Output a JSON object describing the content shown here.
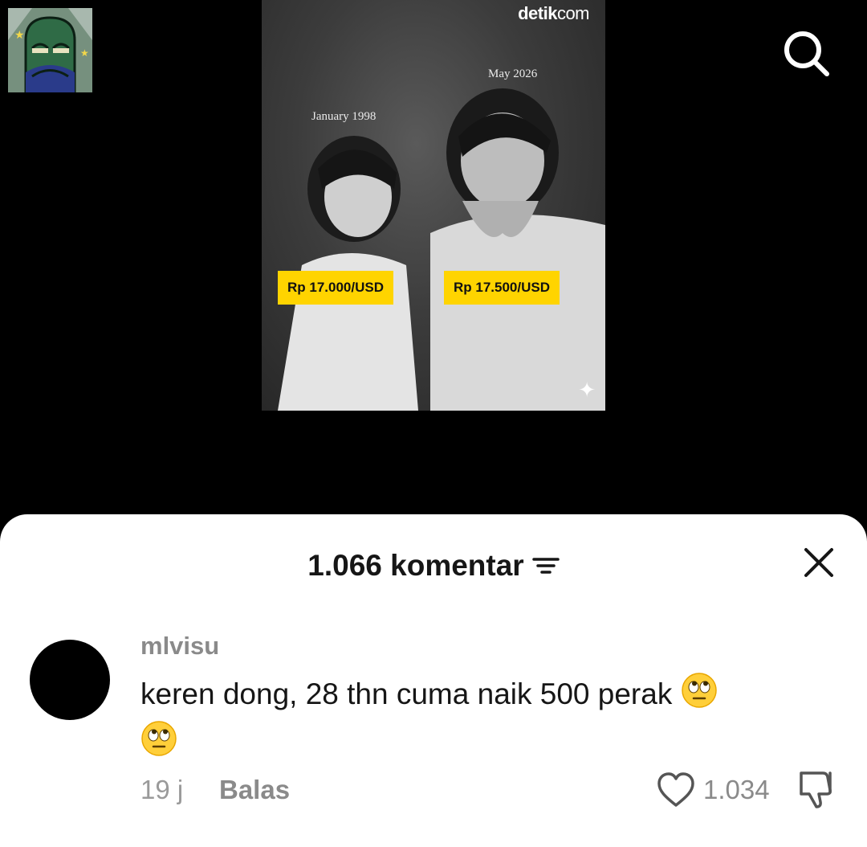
{
  "header": {
    "search_icon": "search-icon"
  },
  "post": {
    "brand_prefix": "detik",
    "brand_suffix": "com",
    "date_left": "January 1998",
    "date_right": "May 2026",
    "price_left": "Rp 17.000/USD",
    "price_right": "Rp 17.500/USD",
    "tag_color": "#ffd400"
  },
  "comments_sheet": {
    "title": "1.066 komentar",
    "filter_icon": "filter-icon",
    "close_icon": "close-icon"
  },
  "comment": {
    "username": "mlvisu",
    "text": "keren dong, 28 thn cuma naik 500 perak",
    "emoji": "face-with-rolling-eyes",
    "time": "19 j",
    "reply_label": "Balas",
    "like_count": "1.034"
  }
}
